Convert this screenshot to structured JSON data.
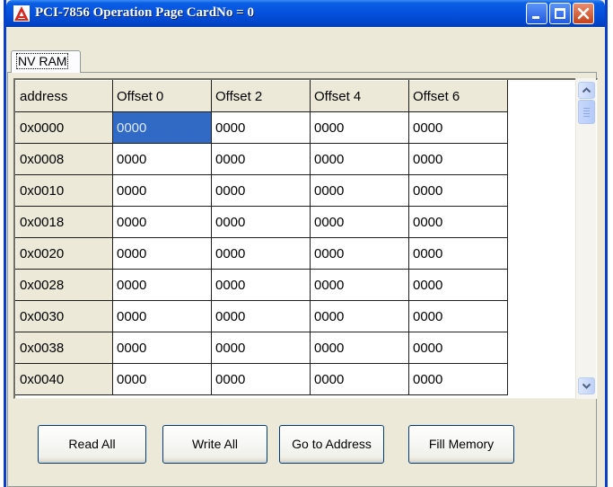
{
  "window": {
    "title": "PCI-7856 Operation Page CardNo = 0"
  },
  "tabs": [
    {
      "label": "NV RAM",
      "active": true
    }
  ],
  "grid": {
    "columns": [
      "address",
      "Offset 0",
      "Offset 2",
      "Offset 4",
      "Offset 6"
    ],
    "rows": [
      {
        "address": "0x0000",
        "values": [
          "0000",
          "0000",
          "0000",
          "0000"
        ]
      },
      {
        "address": "0x0008",
        "values": [
          "0000",
          "0000",
          "0000",
          "0000"
        ]
      },
      {
        "address": "0x0010",
        "values": [
          "0000",
          "0000",
          "0000",
          "0000"
        ]
      },
      {
        "address": "0x0018",
        "values": [
          "0000",
          "0000",
          "0000",
          "0000"
        ]
      },
      {
        "address": "0x0020",
        "values": [
          "0000",
          "0000",
          "0000",
          "0000"
        ]
      },
      {
        "address": "0x0028",
        "values": [
          "0000",
          "0000",
          "0000",
          "0000"
        ]
      },
      {
        "address": "0x0030",
        "values": [
          "0000",
          "0000",
          "0000",
          "0000"
        ]
      },
      {
        "address": "0x0038",
        "values": [
          "0000",
          "0000",
          "0000",
          "0000"
        ]
      },
      {
        "address": "0x0040",
        "values": [
          "0000",
          "0000",
          "0000",
          "0000"
        ]
      }
    ],
    "selected_cell": {
      "row": 0,
      "col": 0
    }
  },
  "buttons": {
    "read_all": "Read All",
    "write_all": "Write All",
    "go_to_address": "Go to Address",
    "fill_memory": "Fill Memory"
  },
  "colors": {
    "titlebar": "#0551dd",
    "selection": "#316ac5",
    "face": "#ece9d8",
    "close_button": "#c5421a"
  },
  "icons": {
    "app": "app-logo-icon",
    "minimize": "minimize-icon",
    "maximize": "maximize-icon",
    "close": "close-icon",
    "scroll_up": "chevron-up-icon",
    "scroll_down": "chevron-down-icon"
  }
}
